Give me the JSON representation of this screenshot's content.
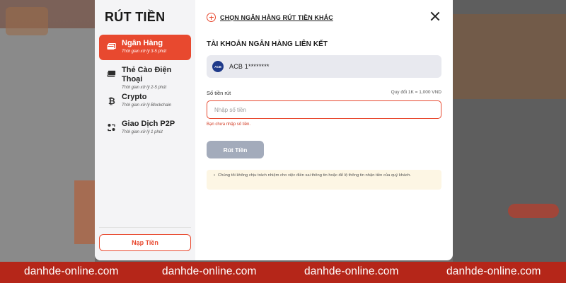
{
  "sidebar": {
    "title": "RÚT TIỀN",
    "items": [
      {
        "label": "Ngân Hàng",
        "sub": "Thời gian xử lý 3-5 phút",
        "icon": "bank-card-icon",
        "active": true
      },
      {
        "label": "Thẻ Cào Điện Thoại",
        "sub": "Thời gian xử lý 2-5 phút",
        "icon": "scratch-card-icon",
        "active": false
      },
      {
        "label": "Crypto",
        "sub": "Thời gian xử lý Blockchain",
        "icon": "bitcoin-icon",
        "active": false
      },
      {
        "label": "Giao Dịch P2P",
        "sub": "Thời gian xử lý 1 phút",
        "icon": "p2p-exchange-icon",
        "active": false
      }
    ],
    "deposit_label": "Nạp Tiền"
  },
  "main": {
    "other_bank_label": "CHỌN NGÂN HÀNG RÚT TIỀN KHÁC",
    "section_title": "TÀI KHOẢN NGÂN HÀNG LIÊN KẾT",
    "bank": {
      "logo_text": "ACB",
      "account": "ACB 1********"
    },
    "amount_label": "Số tiền rút",
    "rate_label": "Quy đổi 1K = 1,000 VND",
    "amount_placeholder": "Nhập số tiền",
    "amount_value": "",
    "error_text": "Bạn chưa nhập số tiền.",
    "submit_label": "Rút Tiền",
    "note": "Chúng tôi không chịu trách nhiệm cho việc điền sai thông tin hoặc để lộ thông tin nhận tiền của quý khách."
  },
  "footer": {
    "items": [
      "danhde-online.com",
      "danhde-online.com",
      "danhde-online.com",
      "danhde-online.com"
    ]
  },
  "colors": {
    "accent": "#e8492f",
    "footer_bg": "#b52619",
    "submit_disabled": "#a3abbb"
  }
}
